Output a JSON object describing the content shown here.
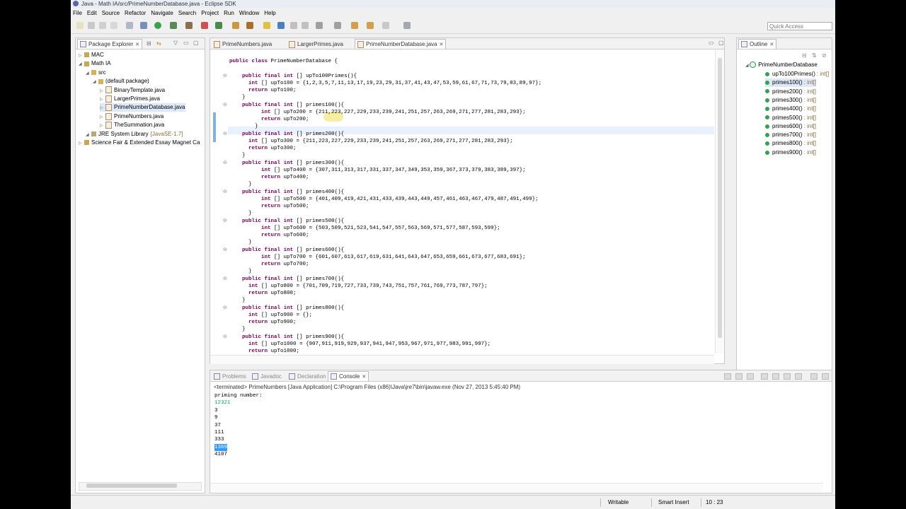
{
  "window": {
    "title": "Java - Math IA/src/PrimeNumberDatabase.java - Eclipse SDK"
  },
  "menu": [
    "File",
    "Edit",
    "Source",
    "Refactor",
    "Navigate",
    "Search",
    "Project",
    "Run",
    "Window",
    "Help"
  ],
  "quick_access": {
    "placeholder": "Quick Access"
  },
  "package_explorer": {
    "tab": "Package Explorer",
    "tree": [
      {
        "label": "MAC",
        "level": 0,
        "icon": "project-icon"
      },
      {
        "label": "Math IA",
        "level": 0,
        "icon": "project-icon"
      },
      {
        "label": "src",
        "level": 1,
        "icon": "package-folder-icon"
      },
      {
        "label": "(default package)",
        "level": 2,
        "icon": "package-icon"
      },
      {
        "label": "BinaryTemplate.java",
        "level": 3,
        "icon": "java-file-icon"
      },
      {
        "label": "LargerPrimes.java",
        "level": 3,
        "icon": "java-file-icon"
      },
      {
        "label": "PrimeNumberDatabase.java",
        "level": 3,
        "icon": "java-file-icon",
        "selected": true
      },
      {
        "label": "PrimeNumbers.java",
        "level": 3,
        "icon": "java-file-icon"
      },
      {
        "label": "TheSummation.java",
        "level": 3,
        "icon": "java-file-icon"
      },
      {
        "label": "JRE System Library",
        "suffix": "[JavaSE-1.7]",
        "level": 1,
        "icon": "library-icon"
      },
      {
        "label": "Science Fair & Extended Essay Magnet Ca",
        "level": 0,
        "icon": "project-icon"
      }
    ]
  },
  "editor": {
    "tabs": [
      {
        "label": "PrimeNumbers.java",
        "active": false
      },
      {
        "label": "LargerPrimes.java",
        "active": false
      },
      {
        "label": "PrimeNumberDatabase.java",
        "active": true
      }
    ],
    "lines": [
      "public class PrimeNumberDatabase {",
      "",
      "    public final int [] upTo100Primes(){",
      "      int [] upTo100 = {1,2,3,5,7,11,13,17,19,23,29,31,37,41,43,47,53,59,61,67,71,73,79,83,89,97};",
      "      return upTo100;",
      "    }",
      "    public final int [] primes100(){",
      "          int [] upTo200 = {211,223,227,229,233,239,241,251,257,263,269,271,277,281,283,293};",
      "          return upTo200;",
      "        }",
      "    public final int [] primes200(){",
      "      int [] upTo300 = {211,223,227,229,233,239,241,251,257,263,269,271,277,281,283,293};",
      "      return upTo300;",
      "    }",
      "    public final int [] primes300(){",
      "          int [] upTo400 = {307,311,313,317,331,337,347,349,353,359,367,373,379,383,389,397};",
      "          return upTo400;",
      "      }",
      "    public final int [] primes400(){",
      "          int [] upTo500 = {401,409,419,421,431,433,439,443,449,457,461,463,467,479,487,491,499};",
      "          return upTo500;",
      "      }",
      "    public final int [] primes500(){",
      "          int [] upTo600 = {503,509,521,523,541,547,557,563,569,571,577,587,593,599};",
      "          return upTo600;",
      "      }",
      "    public final int [] primes600(){",
      "          int [] upTo700 = {601,607,613,617,619,631,641,643,647,653,659,661,673,677,683,691};",
      "          return upTo700;",
      "      }",
      "    public final int [] primes700(){",
      "      int [] upTo800 = {701,709,719,727,733,739,743,751,757,761,769,773,787,797};",
      "      return upTo800;",
      "    }",
      "    public final int [] primes800(){",
      "      int [] upTo900 = {};",
      "      return upTo900;",
      "    }",
      "    public final int [] primes900(){",
      "      int [] upTo1000 = {907,911,919,929,937,941,947,953,967,971,977,983,991,997};",
      "      return upTo1000;"
    ]
  },
  "outline": {
    "tab": "Outline",
    "class_name": "PrimeNumberDatabase",
    "items": [
      {
        "name": "upTo100Primes()",
        "type": ": int[]"
      },
      {
        "name": "primes100()",
        "type": ": int[]",
        "selected": true
      },
      {
        "name": "primes200()",
        "type": ": int[]"
      },
      {
        "name": "primes300()",
        "type": ": int[]"
      },
      {
        "name": "primes400()",
        "type": ": int[]"
      },
      {
        "name": "primes500()",
        "type": ": int[]"
      },
      {
        "name": "primes600()",
        "type": ": int[]"
      },
      {
        "name": "primes700()",
        "type": ": int[]"
      },
      {
        "name": "primes800()",
        "type": ": int[]"
      },
      {
        "name": "primes900()",
        "type": ": int[]"
      }
    ]
  },
  "bottom": {
    "tabs": [
      {
        "label": "Problems",
        "active": false
      },
      {
        "label": "Javadoc",
        "active": false
      },
      {
        "label": "Declaration",
        "active": false
      },
      {
        "label": "Console",
        "active": true
      }
    ],
    "terminated": "<terminated> PrimeNumbers [Java Application] C:\\Program Files (x86)\\Java\\jre7\\bin\\javaw.exe (Nov 27, 2013 5:45:40 PM)",
    "output": [
      {
        "text": "priming number:",
        "style": "normal"
      },
      {
        "text": "12321",
        "style": "input"
      },
      {
        "text": "3",
        "style": "normal"
      },
      {
        "text": "9",
        "style": "normal"
      },
      {
        "text": "37",
        "style": "normal"
      },
      {
        "text": "111",
        "style": "normal"
      },
      {
        "text": "333",
        "style": "normal"
      },
      {
        "text": "1369",
        "style": "selected"
      },
      {
        "text": "4107",
        "style": "normal"
      }
    ]
  },
  "status": {
    "writable": "Writable",
    "insert_mode": "Smart Insert",
    "position": "10 : 23"
  },
  "colors": {
    "keyword": "#7f0055",
    "console_input": "#00a86b",
    "selection": "#3399ff",
    "current_line": "#e8f2fe"
  }
}
